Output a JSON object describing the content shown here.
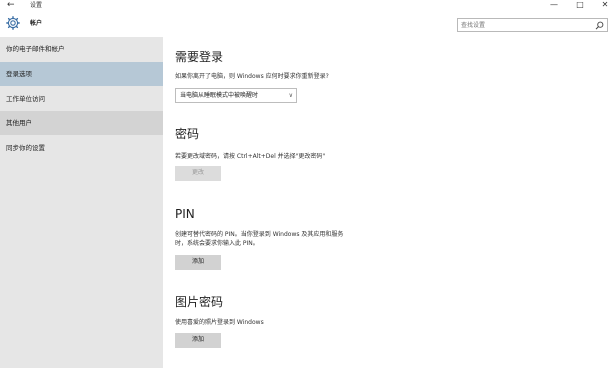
{
  "titlebar": {
    "back": "←",
    "title": "设置",
    "minimize": "—",
    "maximize": "□",
    "close": "✕"
  },
  "header": {
    "title": "帐户",
    "search_placeholder": "查找设置"
  },
  "sidebar": {
    "items": [
      {
        "label": "你的电子邮件和帐户"
      },
      {
        "label": "登录选项"
      },
      {
        "label": "工作单位访问"
      },
      {
        "label": "其他用户"
      },
      {
        "label": "同步你的设置"
      }
    ]
  },
  "sections": {
    "require_signin": {
      "title": "需要登录",
      "desc": "如果你离开了电脑，则 Windows 应何时要求你重新登录?",
      "dropdown_value": "当电脑从睡眠模式中被唤醒时"
    },
    "password": {
      "title": "密码",
      "desc": "若要更改域密码，请按 Ctrl+Alt+Del 并选择\"更改密码\"",
      "button": "更改"
    },
    "pin": {
      "title": "PIN",
      "desc_line1": "创建可替代密码的 PIN。当你登录到 Windows 及其应用和服务",
      "desc_line2": "时，系统会要求你输入此 PIN。",
      "button": "添加"
    },
    "picture_password": {
      "title": "图片密码",
      "desc": "使用喜爱的照片登录到 Windows",
      "button": "添加"
    }
  },
  "colors": {
    "sidebar_bg": "#e6e6e6",
    "sidebar_selected": "#b6c8d6",
    "sidebar_hover": "#d3d3d3",
    "button_bg": "#d2d2d2"
  }
}
